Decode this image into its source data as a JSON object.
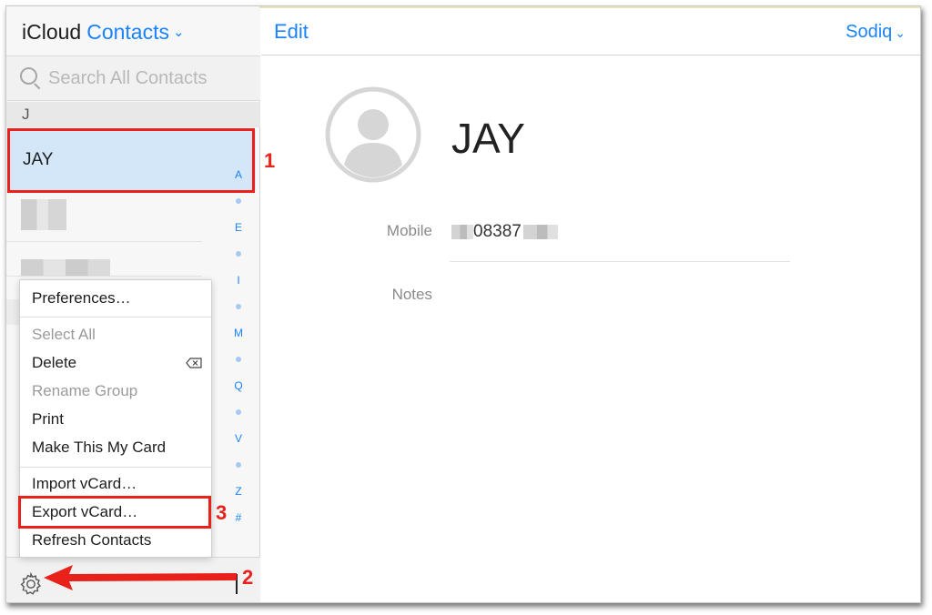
{
  "sidebar": {
    "brand": "iCloud",
    "app_name": "Contacts",
    "search_placeholder": "Search All Contacts",
    "section_letter": "J",
    "selected_contact": "JAY",
    "index_letters": [
      "A",
      "E",
      "I",
      "M",
      "Q",
      "V",
      "Z",
      "#"
    ]
  },
  "menu": {
    "items": [
      {
        "label": "Preferences…",
        "enabled": true
      },
      {
        "label": "Select All",
        "enabled": false
      },
      {
        "label": "Delete",
        "enabled": true
      },
      {
        "label": "Rename Group",
        "enabled": false
      },
      {
        "label": "Print",
        "enabled": true
      },
      {
        "label": "Make This My Card",
        "enabled": true
      },
      {
        "label": "Import vCard…",
        "enabled": true
      },
      {
        "label": "Export vCard…",
        "enabled": true
      },
      {
        "label": "Refresh Contacts",
        "enabled": true
      }
    ]
  },
  "detail": {
    "edit_label": "Edit",
    "account_name": "Sodiq",
    "contact_name": "JAY",
    "fields": {
      "mobile_label": "Mobile",
      "mobile_value_visible": "08387",
      "notes_label": "Notes"
    }
  },
  "annotations": {
    "step1": "1",
    "step2": "2",
    "step3": "3",
    "color": "#e8221b"
  },
  "colors": {
    "accent": "#1a82fb",
    "selected_row": "#d4e7f9"
  }
}
